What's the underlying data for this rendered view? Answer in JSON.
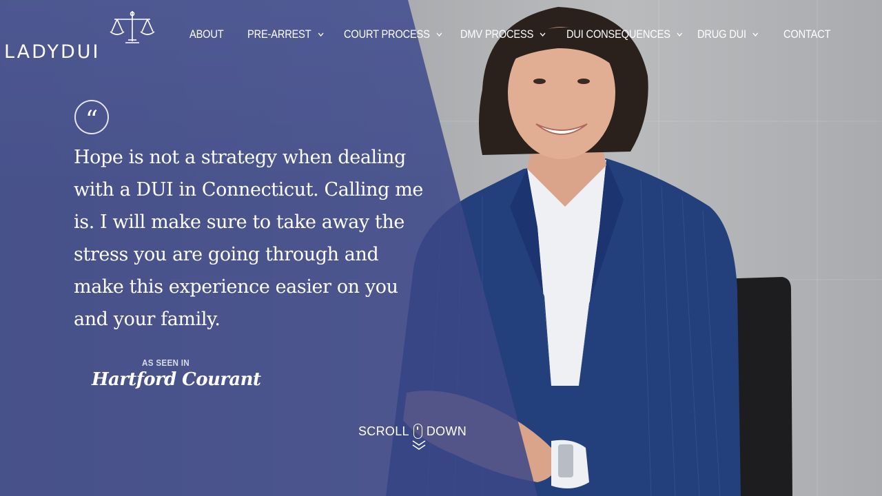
{
  "brand": {
    "logo_text": "LADYDUI"
  },
  "nav": {
    "items": [
      {
        "label": "ABOUT",
        "has_dropdown": false
      },
      {
        "label": "PRE-ARREST",
        "has_dropdown": true
      },
      {
        "label": "COURT PROCESS",
        "has_dropdown": true
      },
      {
        "label": "DMV PROCESS",
        "has_dropdown": true
      },
      {
        "label": "DUI CONSEQUENCES",
        "has_dropdown": true
      },
      {
        "label": "DRUG DUI",
        "has_dropdown": true
      },
      {
        "label": "CONTACT",
        "has_dropdown": false
      }
    ]
  },
  "hero": {
    "quote_mark": "“",
    "quote": "Hope is not a strategy when dealing with a DUI in Connecticut. Calling me is. I will make sure to take away the stress you are going through and make this experience easier on you and your family.",
    "as_seen_in": "AS SEEN IN",
    "press_name": "Hartford Courant",
    "scroll_left": "SCROLL",
    "scroll_right": "DOWN"
  },
  "colors": {
    "overlay": "#3d4788",
    "text": "#ffffff",
    "suit": "#1f3a78",
    "wall": "#a8aaad"
  },
  "icons": {
    "logo": "scales-of-justice-icon",
    "quote": "quote-icon",
    "dropdown": "chevron-down-icon",
    "scroll": "mouse-icon",
    "scroll_arrow": "double-chevron-down-icon"
  }
}
